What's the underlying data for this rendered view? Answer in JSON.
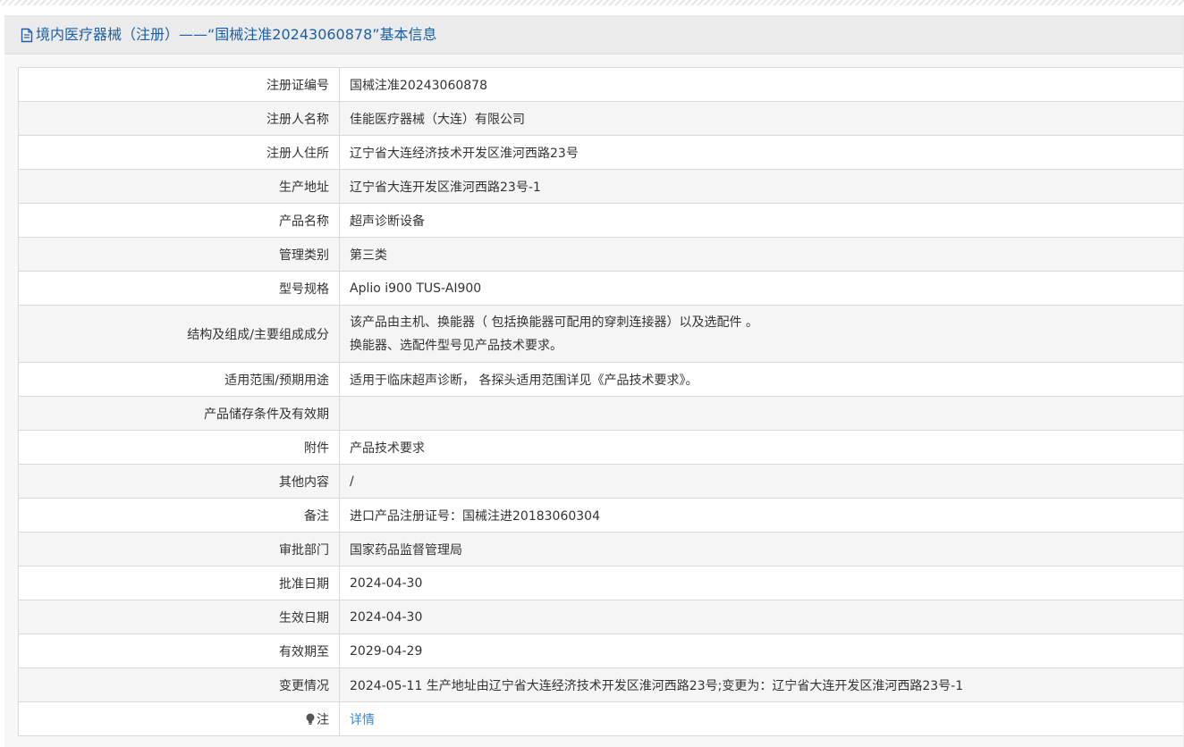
{
  "header": {
    "icon": "document-icon",
    "title": "境内医疗器械（注册）——“国械注准20243060878”基本信息"
  },
  "rows": [
    {
      "label": "注册证编号",
      "value": "国械注准20243060878"
    },
    {
      "label": "注册人名称",
      "value": "佳能医疗器械（大连）有限公司"
    },
    {
      "label": "注册人住所",
      "value": "辽宁省大连经济技术开发区淮河西路23号"
    },
    {
      "label": "生产地址",
      "value": "辽宁省大连开发区淮河西路23号-1"
    },
    {
      "label": "产品名称",
      "value": "超声诊断设备"
    },
    {
      "label": "管理类别",
      "value": "第三类"
    },
    {
      "label": "型号规格",
      "value": "Aplio i900 TUS-AI900"
    },
    {
      "label": "结构及组成/主要组成成分",
      "value_line1": "该产品由主机、换能器（ 包括换能器可配用的穿刺连接器）以及选配件 。",
      "value_line2": "换能器、选配件型号见产品技术要求。"
    },
    {
      "label": "适用范围/预期用途",
      "value": "适用于临床超声诊断， 各探头适用范围详见《产品技术要求》。"
    },
    {
      "label": "产品储存条件及有效期",
      "value": ""
    },
    {
      "label": "附件",
      "value": "产品技术要求"
    },
    {
      "label": "其他内容",
      "value": "/"
    },
    {
      "label": "备注",
      "value": "进口产品注册证号：国械注进20183060304"
    },
    {
      "label": "审批部门",
      "value": "国家药品监督管理局"
    },
    {
      "label": "批准日期",
      "value": "2024-04-30"
    },
    {
      "label": "生效日期",
      "value": "2024-04-30"
    },
    {
      "label": "有效期至",
      "value": "2029-04-29"
    },
    {
      "label": "变更情况",
      "value": "2024-05-11 生产地址由辽宁省大连经济技术开发区淮河西路23号;变更为：辽宁省大连开发区淮河西路23号-1"
    },
    {
      "label": "注",
      "label_icon": "lightbulb-icon",
      "value": "详情"
    }
  ],
  "colors": {
    "title_blue": "#1a5fa8",
    "link_blue": "#3d86d0",
    "header_bg": "#ebebeb",
    "border": "#d9d9d9",
    "stripe_row": "#f5f5f5"
  }
}
